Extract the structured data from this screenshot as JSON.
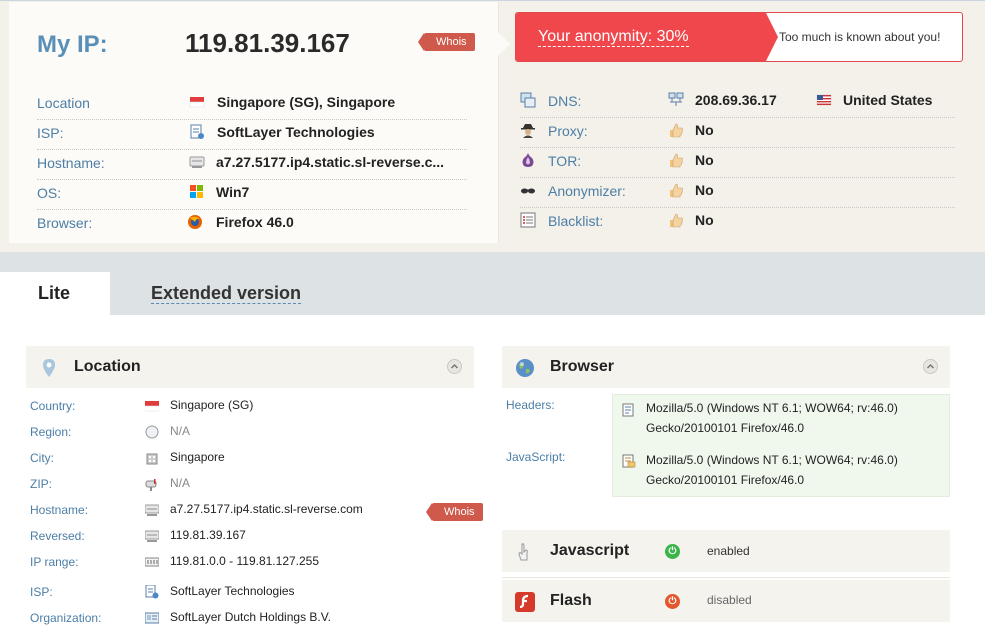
{
  "header": {
    "my_ip_label": "My IP:",
    "ip_value": "119.81.39.167",
    "whois_label": "Whois",
    "anonymity_text": "Your anonymity: 30%",
    "anonymity_message": "Too much is known about you!"
  },
  "ip_info": [
    {
      "label": "Location",
      "value": "Singapore (SG), Singapore"
    },
    {
      "label": "ISP:",
      "value": "SoftLayer Technologies"
    },
    {
      "label": "Hostname:",
      "value": "a7.27.5177.ip4.static.sl-reverse.c..."
    },
    {
      "label": "OS:",
      "value": "Win7"
    },
    {
      "label": "Browser:",
      "value": "Firefox 46.0"
    }
  ],
  "checks": [
    {
      "label": "DNS:",
      "value": "208.69.36.17",
      "country": "United States"
    },
    {
      "label": "Proxy:",
      "value": "No"
    },
    {
      "label": "TOR:",
      "value": "No"
    },
    {
      "label": "Anonymizer:",
      "value": "No"
    },
    {
      "label": "Blacklist:",
      "value": "No"
    }
  ],
  "tabs": {
    "lite": "Lite",
    "extended": "Extended version"
  },
  "location_panel": {
    "title": "Location",
    "whois_label": "Whois",
    "rows": [
      {
        "label": "Country:",
        "value": "Singapore (SG)"
      },
      {
        "label": "Region:",
        "value": "N/A"
      },
      {
        "label": "City:",
        "value": "Singapore"
      },
      {
        "label": "ZIP:",
        "value": "N/A"
      },
      {
        "label": "Hostname:",
        "value": "a7.27.5177.ip4.static.sl-reverse.com"
      },
      {
        "label": "Reversed:",
        "value": "119.81.39.167"
      },
      {
        "label": "IP range:",
        "value": "119.81.0.0 - 119.81.127.255"
      },
      {
        "label": "ISP:",
        "value": "SoftLayer Technologies"
      },
      {
        "label": "Organization:",
        "value": "SoftLayer Dutch Holdings B.V."
      }
    ]
  },
  "browser_panel": {
    "title": "Browser",
    "headers_label": "Headers:",
    "headers_line1": "Mozilla/5.0 (Windows NT 6.1; WOW64; rv:46.0)",
    "headers_line2": "Gecko/20100101 Firefox/46.0",
    "javascript_label": "JavaScript:",
    "javascript_line1": "Mozilla/5.0 (Windows NT 6.1; WOW64; rv:46.0)",
    "javascript_line2": "Gecko/20100101 Firefox/46.0"
  },
  "javascript_panel": {
    "title": "Javascript",
    "status": "enabled"
  },
  "flash_panel": {
    "title": "Flash",
    "status": "disabled"
  },
  "colors": {
    "accent_blue": "#4c7ea6",
    "alert_red": "#f0474c",
    "enabled_green": "#3bb54a",
    "disabled_orange": "#e4572e",
    "whois_red": "#cf5a4c"
  },
  "icons": {
    "ip_info": [
      "singapore-flag-icon",
      "isp-document-icon",
      "server-icon",
      "windows-icon",
      "firefox-icon"
    ],
    "checks": [
      "dns-icon",
      "proxy-spy-icon",
      "tor-onion-icon",
      "anonymizer-glasses-icon",
      "blacklist-icon"
    ],
    "check_status": [
      "network-icon",
      "thumbs-up-icon",
      "thumbs-up-icon",
      "thumbs-up-icon",
      "thumbs-up-icon"
    ],
    "location_rows": [
      "singapore-flag-icon",
      "compass-icon",
      "building-icon",
      "mailbox-icon",
      "server-icon",
      "server-icon",
      "ip-range-icon",
      "isp-document-icon",
      "id-card-icon"
    ]
  }
}
